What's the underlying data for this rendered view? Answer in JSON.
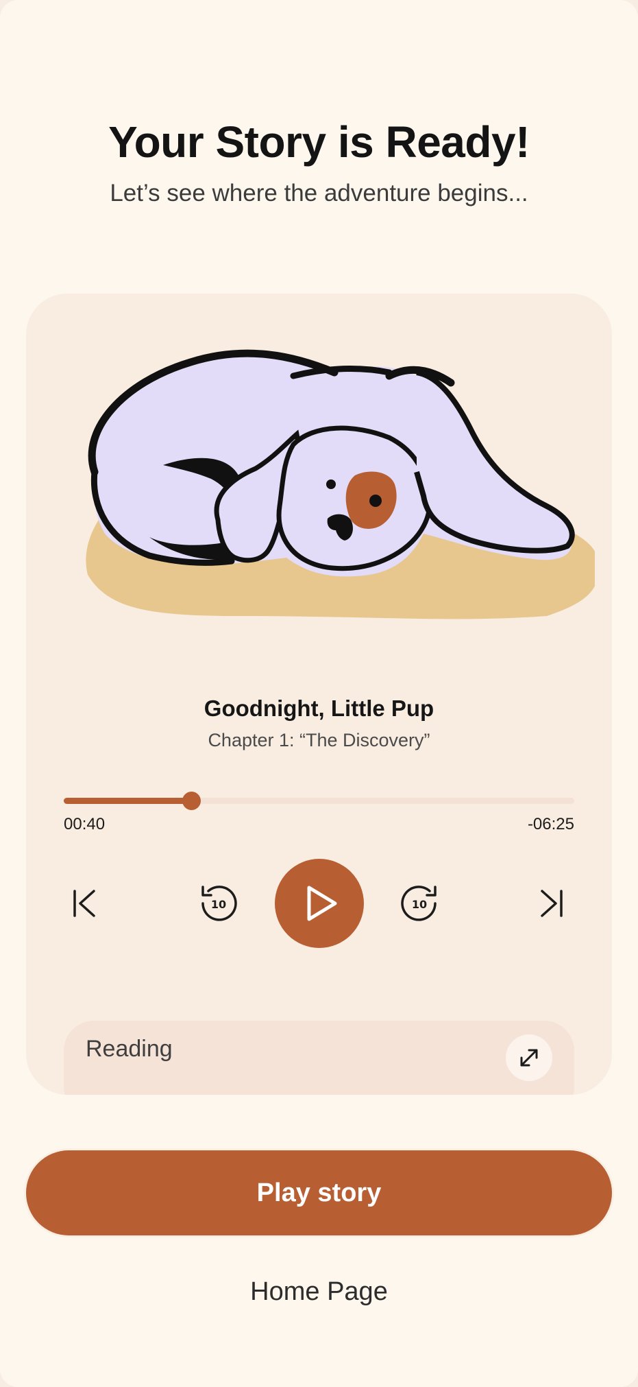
{
  "header": {
    "title": "Your Story is Ready!",
    "subtitle": "Let’s see where the adventure begins..."
  },
  "player": {
    "illustration": "sleeping-puppy",
    "story_title": "Goodnight, Little Pup",
    "chapter": "Chapter 1: “The Discovery”",
    "progress": 0.25,
    "time_elapsed": "00:40",
    "time_remaining": "-06:25",
    "controls": {
      "previous": "skip-previous-icon",
      "rewind": "rewind-10-icon",
      "rewind_label": "10",
      "play": "play-icon",
      "forward": "forward-10-icon",
      "forward_label": "10",
      "next": "skip-next-icon"
    },
    "reading": {
      "label": "Reading",
      "expand_icon": "expand-icon"
    }
  },
  "actions": {
    "play_story": "Play story",
    "home_page": "Home Page"
  },
  "colors": {
    "accent": "#b85e33",
    "background": "#fdf7ee",
    "card": "#f9ede1",
    "puppy_body": "#e2dcf8",
    "puppy_spot": "#b85e33",
    "cushion": "#e8c78f"
  }
}
